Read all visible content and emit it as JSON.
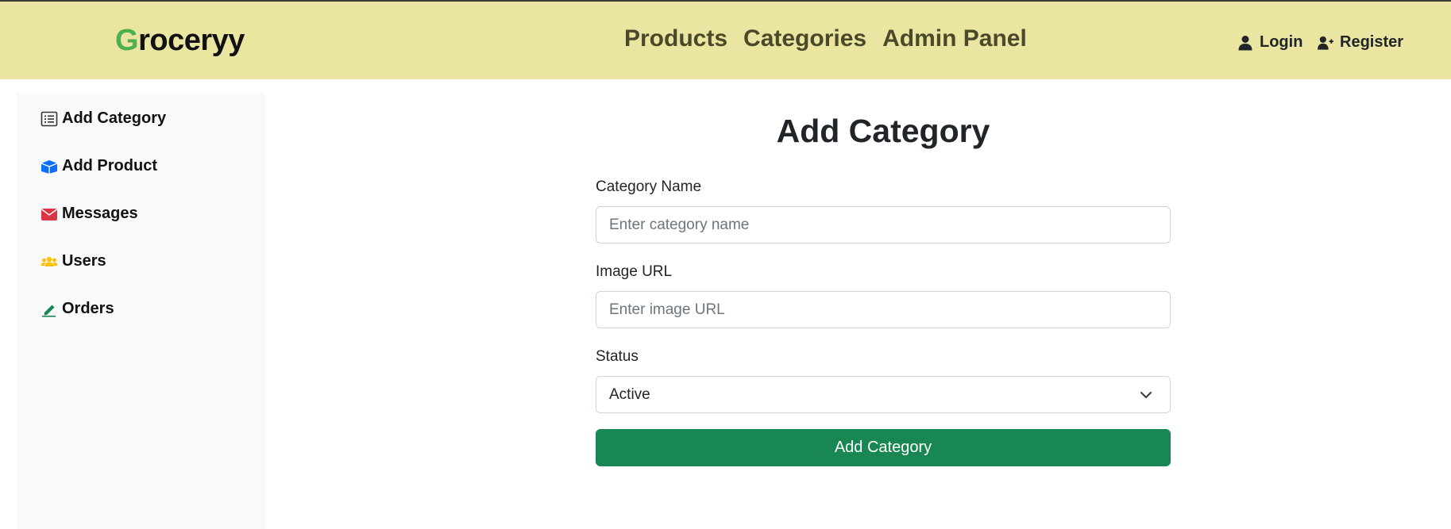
{
  "brand": {
    "first_letter": "G",
    "rest": "roceryy"
  },
  "nav": {
    "products": "Products",
    "categories": "Categories",
    "admin_panel": "Admin Panel"
  },
  "auth": {
    "login": "Login",
    "register": "Register"
  },
  "sidebar": {
    "items": [
      {
        "label": "Add Category",
        "icon": "list-icon"
      },
      {
        "label": "Add Product",
        "icon": "box-icon"
      },
      {
        "label": "Messages",
        "icon": "envelope-icon"
      },
      {
        "label": "Users",
        "icon": "users-icon"
      },
      {
        "label": "Orders",
        "icon": "pen-icon"
      }
    ]
  },
  "form": {
    "title": "Add Category",
    "category_name_label": "Category Name",
    "category_name_placeholder": "Enter category name",
    "image_url_label": "Image URL",
    "image_url_placeholder": "Enter image URL",
    "status_label": "Status",
    "status_value": "Active",
    "submit_label": "Add Category"
  },
  "colors": {
    "header_bg": "#eae5a1",
    "brand_accent": "#4caf50",
    "sidebar_bg": "#f8f9fa",
    "button_bg": "#198754",
    "messages_icon": "#dc3545",
    "product_icon": "#0d6efd",
    "users_icon": "#ffc107",
    "orders_icon": "#198754"
  }
}
